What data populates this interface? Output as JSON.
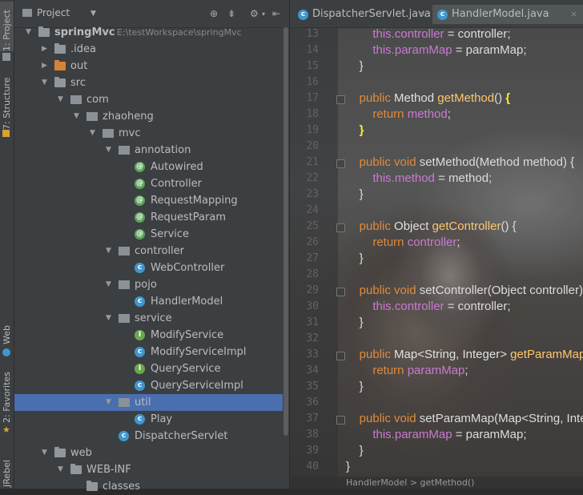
{
  "side_tabs": {
    "project": "1: Project",
    "structure": "7: Structure",
    "web": "Web",
    "favorites": "2: Favorites",
    "jrebel": "JRebel"
  },
  "project_panel": {
    "title": "Project",
    "tree": [
      {
        "label": "springMvc",
        "suffix": "E:\\testWorkspace\\springMvc",
        "icon": "module-folder-icon",
        "arrow": "down"
      },
      {
        "label": ".idea",
        "icon": "folder-icon",
        "arrow": "right"
      },
      {
        "label": "out",
        "icon": "folder-orange-icon",
        "arrow": "right"
      },
      {
        "label": "src",
        "icon": "folder-icon",
        "arrow": "down"
      },
      {
        "label": "com",
        "icon": "package-icon",
        "arrow": "down"
      },
      {
        "label": "zhaoheng",
        "icon": "package-icon",
        "arrow": "down"
      },
      {
        "label": "mvc",
        "icon": "package-icon",
        "arrow": "down"
      },
      {
        "label": "annotation",
        "icon": "package-icon",
        "arrow": "down"
      },
      {
        "label": "Autowired",
        "icon": "annotation-icon"
      },
      {
        "label": "Controller",
        "icon": "annotation-icon"
      },
      {
        "label": "RequestMapping",
        "icon": "annotation-icon"
      },
      {
        "label": "RequestParam",
        "icon": "annotation-icon"
      },
      {
        "label": "Service",
        "icon": "annotation-icon"
      },
      {
        "label": "controller",
        "icon": "package-icon",
        "arrow": "down"
      },
      {
        "label": "WebController",
        "icon": "class-icon"
      },
      {
        "label": "pojo",
        "icon": "package-icon",
        "arrow": "down"
      },
      {
        "label": "HandlerModel",
        "icon": "class-icon"
      },
      {
        "label": "service",
        "icon": "package-icon",
        "arrow": "down"
      },
      {
        "label": "ModifyService",
        "icon": "interface-icon"
      },
      {
        "label": "ModifyServiceImpl",
        "icon": "class-icon"
      },
      {
        "label": "QueryService",
        "icon": "interface-icon"
      },
      {
        "label": "QueryServiceImpl",
        "icon": "class-icon"
      },
      {
        "label": "util",
        "icon": "package-icon",
        "arrow": "down",
        "selected": true
      },
      {
        "label": "Play",
        "icon": "class-icon"
      },
      {
        "label": "DispatcherServlet",
        "icon": "class-icon"
      },
      {
        "label": "web",
        "icon": "folder-icon",
        "arrow": "down"
      },
      {
        "label": "WEB-INF",
        "icon": "folder-icon",
        "arrow": "down"
      },
      {
        "label": "classes",
        "icon": "folder-icon"
      }
    ]
  },
  "editor": {
    "tabs": [
      {
        "label": "DispatcherServlet.java",
        "close": "×"
      },
      {
        "label": "HandlerModel.java",
        "close": "×"
      }
    ],
    "line_numbers": [
      "13",
      "14",
      "15",
      "16",
      "17",
      "18",
      "19",
      "20",
      "21",
      "22",
      "23",
      "24",
      "25",
      "26",
      "27",
      "28",
      "29",
      "30",
      "31",
      "32",
      "33",
      "34",
      "35",
      "36",
      "37",
      "38",
      "39",
      "40"
    ],
    "lines": [
      [
        [
          "fld",
          "        this."
        ],
        [
          "fld",
          "controller"
        ],
        [
          "plain",
          " = controller;"
        ]
      ],
      [
        [
          "fld",
          "        this."
        ],
        [
          "fld",
          "paramMap"
        ],
        [
          "plain",
          " = paramMap;"
        ]
      ],
      [
        [
          "plain",
          "    }"
        ]
      ],
      [
        [
          "plain",
          ""
        ]
      ],
      [
        [
          "kw",
          "    public "
        ],
        [
          "typ",
          "Method "
        ],
        [
          "fn",
          "getMethod"
        ],
        [
          "plain",
          "() "
        ],
        [
          "brace",
          "{"
        ]
      ],
      [
        [
          "kw",
          "        return "
        ],
        [
          "fld",
          "method"
        ],
        [
          "plain",
          ";"
        ]
      ],
      [
        [
          "brace",
          "    }"
        ]
      ],
      [
        [
          "plain",
          ""
        ]
      ],
      [
        [
          "kw",
          "    public void "
        ],
        [
          "plain",
          "setMethod(Method method) {"
        ]
      ],
      [
        [
          "fld",
          "        this."
        ],
        [
          "fld",
          "method"
        ],
        [
          "plain",
          " = method;"
        ]
      ],
      [
        [
          "plain",
          "    }"
        ]
      ],
      [
        [
          "plain",
          ""
        ]
      ],
      [
        [
          "kw",
          "    public "
        ],
        [
          "typ",
          "Object "
        ],
        [
          "fn",
          "getController"
        ],
        [
          "plain",
          "() {"
        ]
      ],
      [
        [
          "kw",
          "        return "
        ],
        [
          "fld",
          "controller"
        ],
        [
          "plain",
          ";"
        ]
      ],
      [
        [
          "plain",
          "    }"
        ]
      ],
      [
        [
          "plain",
          ""
        ]
      ],
      [
        [
          "kw",
          "    public void "
        ],
        [
          "plain",
          "setController(Object controller) {"
        ]
      ],
      [
        [
          "fld",
          "        this."
        ],
        [
          "fld",
          "controller"
        ],
        [
          "plain",
          " = controller;"
        ]
      ],
      [
        [
          "plain",
          "    }"
        ]
      ],
      [
        [
          "plain",
          ""
        ]
      ],
      [
        [
          "kw",
          "    public "
        ],
        [
          "typ",
          "Map<String, Integer> "
        ],
        [
          "fn",
          "getParamMap"
        ],
        [
          "plain",
          "() {"
        ]
      ],
      [
        [
          "kw",
          "        return "
        ],
        [
          "fld",
          "paramMap"
        ],
        [
          "plain",
          ";"
        ]
      ],
      [
        [
          "plain",
          "    }"
        ]
      ],
      [
        [
          "plain",
          ""
        ]
      ],
      [
        [
          "kw",
          "    public void "
        ],
        [
          "plain",
          "setParamMap(Map<String, Integer> paramMap) {"
        ]
      ],
      [
        [
          "fld",
          "        this."
        ],
        [
          "fld",
          "paramMap"
        ],
        [
          "plain",
          " = paramMap;"
        ]
      ],
      [
        [
          "plain",
          "    }"
        ]
      ],
      [
        [
          "plain",
          "}"
        ]
      ]
    ],
    "breadcrumb": "HandlerModel > getMethod()"
  },
  "colors": {
    "keyword": "#e08a3c",
    "field": "#c87bd2",
    "function": "#ffc66d",
    "selection": "#4b6eaf"
  }
}
